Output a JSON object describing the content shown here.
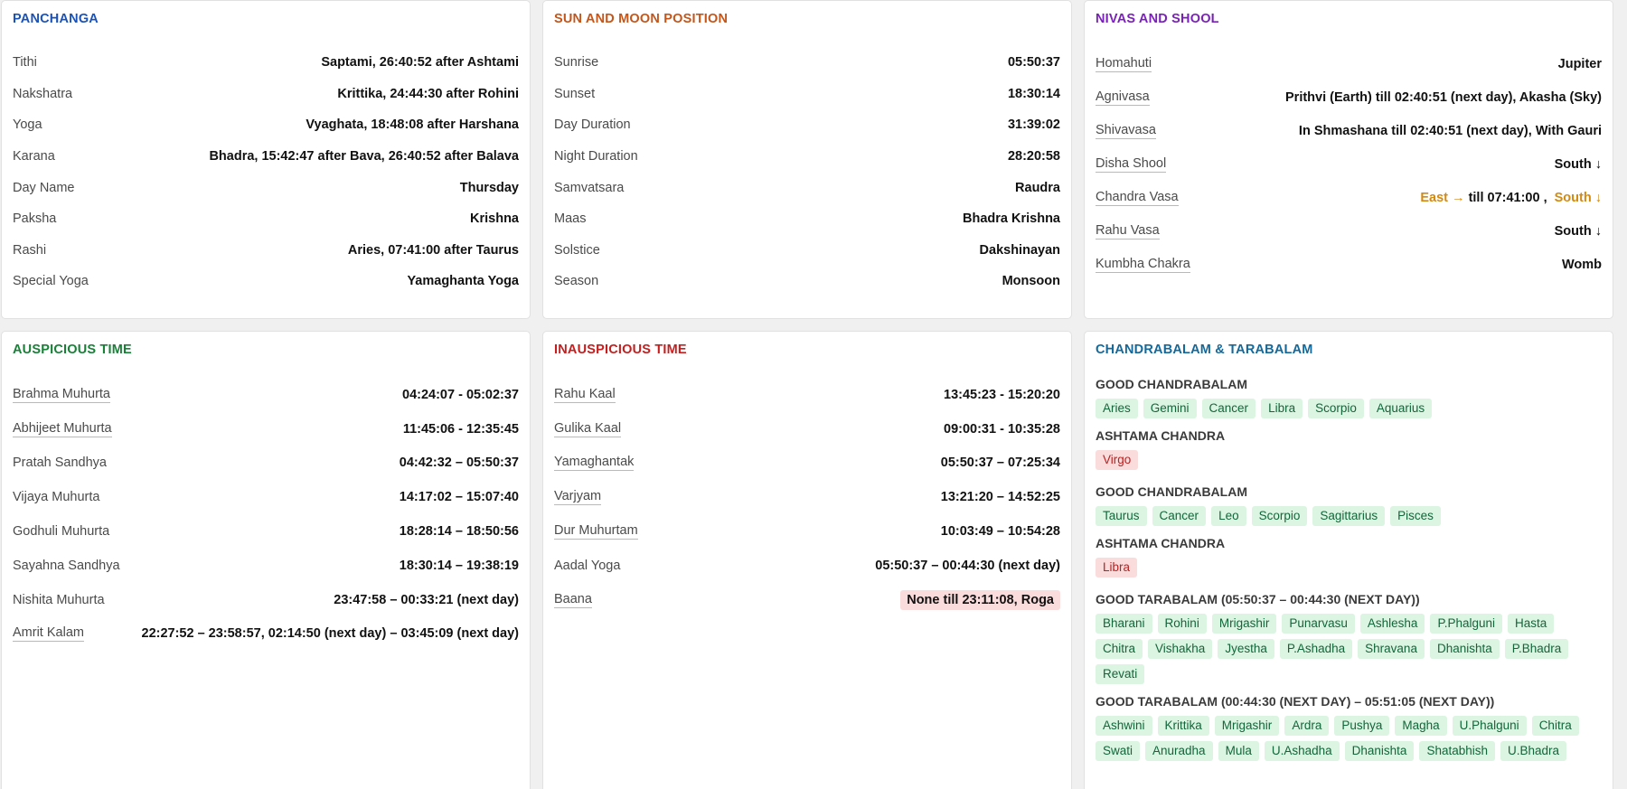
{
  "colors": {
    "panchanga": "#1a52b8",
    "sun_moon": "#c4561b",
    "nivas": "#7a22b8",
    "auspicious": "#198038",
    "inauspicious": "#c41e1e",
    "chandrabalam": "#14699a"
  },
  "panchanga": {
    "title": "PANCHANGA",
    "rows": [
      {
        "label": "Tithi",
        "value": "Saptami, 26:40:52 after Ashtami"
      },
      {
        "label": "Nakshatra",
        "value": "Krittika, 24:44:30 after Rohini"
      },
      {
        "label": "Yoga",
        "value": "Vyaghata, 18:48:08 after Harshana"
      },
      {
        "label": "Karana",
        "value": "Bhadra, 15:42:47 after Bava, 26:40:52 after Balava"
      },
      {
        "label": "Day Name",
        "value": "Thursday"
      },
      {
        "label": "Paksha",
        "value": "Krishna"
      },
      {
        "label": "Rashi",
        "value": "Aries, 07:41:00 after Taurus"
      },
      {
        "label": "Special Yoga",
        "value": "Yamaghanta Yoga"
      }
    ]
  },
  "sun_moon": {
    "title": "SUN AND MOON POSITION",
    "rows": [
      {
        "label": "Sunrise",
        "value": "05:50:37"
      },
      {
        "label": "Sunset",
        "value": "18:30:14"
      },
      {
        "label": "Day Duration",
        "value": "31:39:02"
      },
      {
        "label": "Night Duration",
        "value": "28:20:58"
      },
      {
        "label": "Samvatsara",
        "value": "Raudra"
      },
      {
        "label": "Maas",
        "value": "Bhadra Krishna"
      },
      {
        "label": "Solstice",
        "value": "Dakshinayan"
      },
      {
        "label": "Season",
        "value": "Monsoon"
      }
    ]
  },
  "nivas": {
    "title": "NIVAS AND SHOOL",
    "homahuti": {
      "label": "Homahuti",
      "value": "Jupiter"
    },
    "agnivasa": {
      "label": "Agnivasa",
      "value": "Prithvi (Earth) till 02:40:51 (next day), Akasha (Sky)"
    },
    "shivavasa": {
      "label": "Shivavasa",
      "value": "In Shmashana till 02:40:51 (next day), With Gauri"
    },
    "disha_shool": {
      "label": "Disha Shool",
      "value": "South ↓"
    },
    "chandra_vasa": {
      "label": "Chandra Vasa",
      "value_a": "East →",
      "value_b": "till 07:41:00 ,",
      "value_c": "South ↓"
    },
    "rahu_vasa": {
      "label": "Rahu Vasa",
      "value": "South ↓"
    },
    "kumbha_chakra": {
      "label": "Kumbha Chakra",
      "value": "Womb"
    }
  },
  "auspicious": {
    "title": "AUSPICIOUS TIME",
    "rows": [
      {
        "label": "Brahma Muhurta",
        "value": "04:24:07 - 05:02:37"
      },
      {
        "label": "Abhijeet Muhurta",
        "value": "11:45:06 - 12:35:45"
      },
      {
        "label": "Pratah Sandhya",
        "value": "04:42:32 – 05:50:37"
      },
      {
        "label": "Vijaya Muhurta",
        "value": "14:17:02 – 15:07:40"
      },
      {
        "label": "Godhuli Muhurta",
        "value": "18:28:14 – 18:50:56"
      },
      {
        "label": "Sayahna Sandhya",
        "value": "18:30:14 – 19:38:19"
      },
      {
        "label": "Nishita Muhurta",
        "value": "23:47:58 – 00:33:21 (next day)"
      },
      {
        "label": "Amrit Kalam",
        "value": "22:27:52 – 23:58:57, 02:14:50 (next day) – 03:45:09 (next day)"
      }
    ]
  },
  "inauspicious": {
    "title": "INAUSPICIOUS TIME",
    "rows": [
      {
        "label": "Rahu Kaal",
        "value": "13:45:23 - 15:20:20"
      },
      {
        "label": "Gulika Kaal",
        "value": "09:00:31 - 10:35:28"
      },
      {
        "label": "Yamaghantak",
        "value": "05:50:37 – 07:25:34"
      },
      {
        "label": "Varjyam",
        "value": "13:21:20 – 14:52:25"
      },
      {
        "label": "Dur Muhurtam",
        "value": "10:03:49 – 10:54:28"
      },
      {
        "label": "Aadal Yoga",
        "value": "05:50:37 – 00:44:30 (next day)"
      },
      {
        "label": "Baana",
        "value": "None till 23:11:08, Roga"
      }
    ]
  },
  "chandrabalam": {
    "title": "CHANDRABALAM & TARABALAM",
    "good1_title": "GOOD CHANDRABALAM",
    "good1": [
      "Aries",
      "Gemini",
      "Cancer",
      "Libra",
      "Scorpio",
      "Aquarius"
    ],
    "ashtama1_title": "ASHTAMA CHANDRA",
    "ashtama1": [
      "Virgo"
    ],
    "good2_title": "GOOD CHANDRABALAM",
    "good2": [
      "Taurus",
      "Cancer",
      "Leo",
      "Scorpio",
      "Sagittarius",
      "Pisces"
    ],
    "ashtama2_title": "ASHTAMA CHANDRA",
    "ashtama2": [
      "Libra"
    ],
    "tara1_title": "GOOD TARABALAM (05:50:37 – 00:44:30 (NEXT DAY))",
    "tara1": [
      "Bharani",
      "Rohini",
      "Mrigashir",
      "Punarvasu",
      "Ashlesha",
      "P.Phalguni",
      "Hasta",
      "Chitra",
      "Vishakha",
      "Jyestha",
      "P.Ashadha",
      "Shravana",
      "Dhanishta",
      "P.Bhadra",
      "Revati"
    ],
    "tara2_title": "GOOD TARABALAM (00:44:30 (NEXT DAY) – 05:51:05 (NEXT DAY))",
    "tara2": [
      "Ashwini",
      "Krittika",
      "Mrigashir",
      "Ardra",
      "Pushya",
      "Magha",
      "U.Phalguni",
      "Chitra",
      "Swati",
      "Anuradha",
      "Mula",
      "U.Ashadha",
      "Dhanishta",
      "Shatabhish",
      "U.Bhadra"
    ]
  }
}
